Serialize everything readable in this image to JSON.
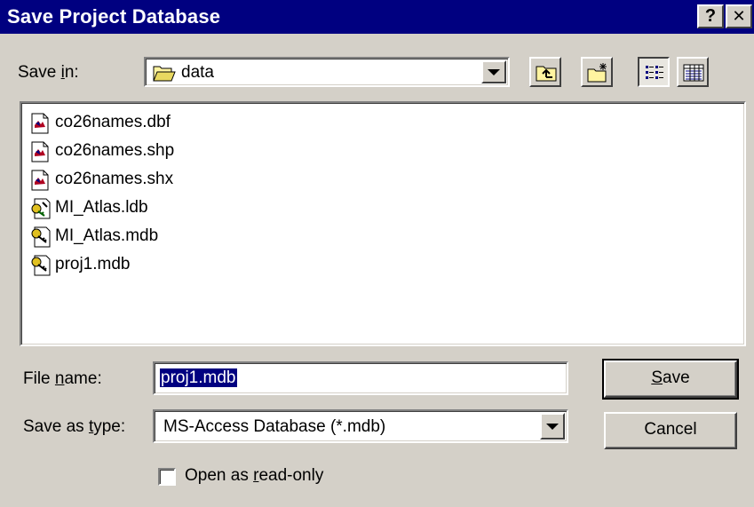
{
  "dialog": {
    "title": "Save Project Database",
    "help_button": "?",
    "close_button": "✕"
  },
  "save_in": {
    "label_pre": "Save ",
    "label_accel": "i",
    "label_post": "n:",
    "current_folder": "data",
    "folder_icon": "folder-open-icon"
  },
  "toolbar": {
    "buttons": [
      {
        "name": "up-one-level",
        "icon": "up-folder-icon"
      },
      {
        "name": "create-new-folder",
        "icon": "new-folder-icon"
      },
      {
        "name": "list-view",
        "icon": "list-view-icon",
        "pressed": true
      },
      {
        "name": "details-view",
        "icon": "details-view-icon"
      }
    ]
  },
  "files": [
    {
      "name": "co26names.dbf",
      "icon": "shapefile-icon"
    },
    {
      "name": "co26names.shp",
      "icon": "shapefile-icon"
    },
    {
      "name": "co26names.shx",
      "icon": "shapefile-icon"
    },
    {
      "name": "MI_Atlas.ldb",
      "icon": "access-lock-icon"
    },
    {
      "name": "MI_Atlas.mdb",
      "icon": "access-database-icon"
    },
    {
      "name": "proj1.mdb",
      "icon": "access-database-icon"
    }
  ],
  "file_name": {
    "label_pre": "File ",
    "label_accel": "n",
    "label_post": "ame:",
    "value": "proj1.mdb"
  },
  "save_as_type": {
    "label_pre": "Save as ",
    "label_accel": "t",
    "label_post": "ype:",
    "value": "MS-Access Database  (*.mdb)"
  },
  "buttons": {
    "save_accel": "S",
    "save_rest": "ave",
    "cancel": "Cancel"
  },
  "read_only": {
    "label_pre": "Open as ",
    "label_accel": "r",
    "label_post": "ead-only",
    "checked": false
  },
  "colors": {
    "titlebar": "#000080",
    "face": "#d4d0c8",
    "selection": "#000080"
  }
}
